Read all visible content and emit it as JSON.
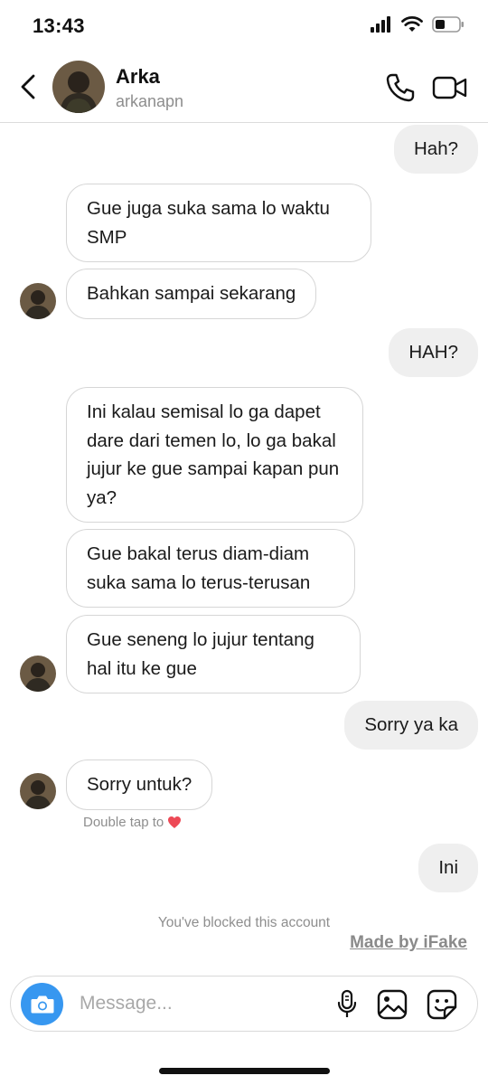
{
  "status_bar": {
    "time": "13:43"
  },
  "header": {
    "name": "Arka",
    "username": "arkanapn"
  },
  "messages": [
    {
      "side": "out",
      "text": "Hah?"
    },
    {
      "side": "in",
      "text": "Gue juga suka sama lo waktu SMP"
    },
    {
      "side": "in",
      "text": "Bahkan sampai sekarang"
    },
    {
      "side": "out",
      "text": "HAH?"
    },
    {
      "side": "in",
      "text": "Ini kalau semisal lo ga dapet dare dari temen lo, lo ga bakal jujur ke gue sampai kapan pun ya?"
    },
    {
      "side": "in",
      "text": "Gue bakal terus diam-diam suka sama lo terus-terusan"
    },
    {
      "side": "in",
      "text": "Gue seneng lo jujur tentang hal itu ke gue"
    },
    {
      "side": "out",
      "text": "Sorry ya ka"
    },
    {
      "side": "in",
      "text": "Sorry untuk?"
    },
    {
      "side": "out",
      "text": "Ini"
    }
  ],
  "double_tap_hint": "Double tap to",
  "blocked_notice": "You've blocked this account",
  "watermark": "Made by iFake",
  "composer": {
    "placeholder": "Message..."
  },
  "icons": {
    "back": "chevron-left-icon",
    "call": "phone-icon",
    "video": "video-camera-icon",
    "camera": "camera-icon",
    "mic": "microphone-icon",
    "gallery": "image-icon",
    "sticker": "sticker-icon",
    "heart": "heart-icon"
  },
  "colors": {
    "accent": "#3797f0",
    "heart": "#ed4956",
    "outgoing_bubble": "#efefef",
    "muted_text": "#8e8e8e"
  }
}
